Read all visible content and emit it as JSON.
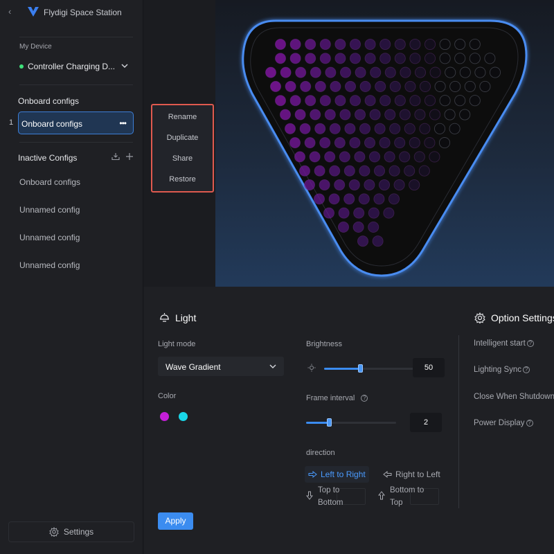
{
  "app": {
    "title": "Flydigi Space Station"
  },
  "sidebar": {
    "my_device_label": "My Device",
    "device_name": "Controller Charging D...",
    "onboard_section": "Onboard configs",
    "active_config": {
      "index": "1",
      "label": "Onboard configs",
      "more": "•••"
    },
    "inactive_section": "Inactive Configs",
    "inactive_items": [
      "Onboard configs",
      "Unnamed config",
      "Unnamed config",
      "Unnamed config"
    ],
    "settings_label": "Settings"
  },
  "context_menu": {
    "items": [
      "Rename",
      "Duplicate",
      "Share",
      "Restore"
    ]
  },
  "light": {
    "title": "Light",
    "mode_label": "Light mode",
    "mode_value": "Wave Gradient",
    "color_label": "Color",
    "colors": [
      "#c41fd8",
      "#19d6e8"
    ],
    "brightness_label": "Brightness",
    "brightness_value": "50",
    "brightness_fraction": 0.4,
    "frame_label": "Frame interval",
    "frame_value": "2",
    "frame_fraction": 0.25,
    "direction_label": "direction",
    "directions": {
      "ltr": "Left to Right",
      "rtl": "Right to Left",
      "ttb_1": "Top to",
      "ttb_2": "Bottom",
      "btt_1": "Bottom to",
      "btt_2": "Top"
    },
    "apply_label": "Apply"
  },
  "options": {
    "title": "Option Settings",
    "items": [
      "Intelligent start",
      "Lighting Sync",
      "Close When Shutdown",
      "Power Display"
    ]
  },
  "colors": {
    "accent": "#3b8cf0",
    "highlight": "#e05a4f"
  }
}
